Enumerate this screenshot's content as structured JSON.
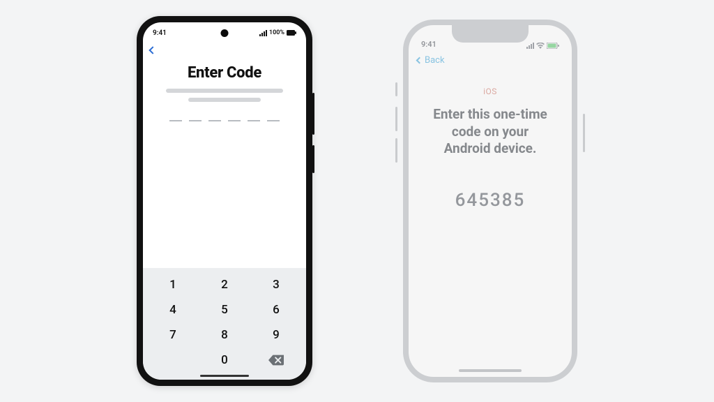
{
  "android": {
    "status": {
      "time": "9:41",
      "battery_label": "100%"
    },
    "title": "Enter Code",
    "code_slots": 6,
    "keypad": {
      "rows": [
        [
          "1",
          "2",
          "3"
        ],
        [
          "4",
          "5",
          "6"
        ],
        [
          "7",
          "8",
          "9"
        ],
        [
          "",
          "0",
          "⌫"
        ]
      ]
    }
  },
  "ios": {
    "status": {
      "time": "9:41"
    },
    "back_label": "Back",
    "brand": "iOS",
    "heading": "Enter this one-time code on your Android device.",
    "code": "645385"
  }
}
